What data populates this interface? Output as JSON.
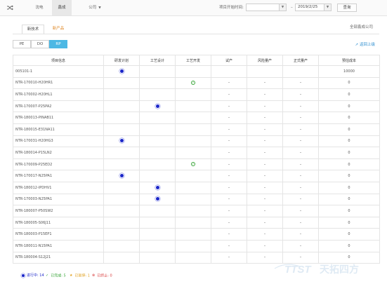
{
  "topbar": {
    "nav": [
      "沈电",
      "鑫成",
      "公司"
    ],
    "date_label": "项目开始时间:",
    "start_date": "",
    "end_date": "2019/2/25",
    "query_label": "查询"
  },
  "tabs": [
    "新技术",
    "新产品"
  ],
  "company_label": "全部鑫成公司",
  "segments": [
    "PE",
    "DO",
    "RP"
  ],
  "back_label": "返回上级",
  "table": {
    "headers": [
      "项目信息",
      "研发计划",
      "工艺设计",
      "工艺开发",
      "试产",
      "风险量产",
      "正式量产",
      "预估成本"
    ],
    "rows": [
      {
        "name": "005101-1",
        "rd": "dot",
        "design": "",
        "dev": "",
        "trial": "",
        "risk": "",
        "mass": "",
        "cost": "10000"
      },
      {
        "name": "NTR-170010-H20HR1",
        "rd": "",
        "design": "",
        "dev": "check",
        "trial": "–",
        "risk": "–",
        "mass": "–",
        "cost": "0"
      },
      {
        "name": "NTR-170002-H20HL1",
        "rd": "",
        "design": "",
        "dev": "",
        "trial": "–",
        "risk": "–",
        "mass": "–",
        "cost": "0"
      },
      {
        "name": "NTR-170007-P25PA2",
        "rd": "",
        "design": "dot",
        "dev": "",
        "trial": "–",
        "risk": "–",
        "mass": "–",
        "cost": "0"
      },
      {
        "name": "NTR-180013-PINAB11",
        "rd": "",
        "design": "",
        "dev": "",
        "trial": "–",
        "risk": "–",
        "mass": "–",
        "cost": "0"
      },
      {
        "name": "NTR-180015-E31NA11",
        "rd": "",
        "design": "",
        "dev": "",
        "trial": "–",
        "risk": "–",
        "mass": "–",
        "cost": "0"
      },
      {
        "name": "NTR-170031-H20HG3",
        "rd": "dot",
        "design": "",
        "dev": "",
        "trial": "–",
        "risk": "–",
        "mass": "–",
        "cost": "0"
      },
      {
        "name": "NTR-180014-P15LN2",
        "rd": "",
        "design": "",
        "dev": "",
        "trial": "–",
        "risk": "–",
        "mass": "–",
        "cost": "0"
      },
      {
        "name": "NTR-170009-P25ED2",
        "rd": "",
        "design": "",
        "dev": "check",
        "trial": "–",
        "risk": "–",
        "mass": "–",
        "cost": "0"
      },
      {
        "name": "NTR-170017-N25PA1",
        "rd": "dot",
        "design": "",
        "dev": "",
        "trial": "–",
        "risk": "–",
        "mass": "–",
        "cost": "0"
      },
      {
        "name": "NTR-180012-IPDHV1",
        "rd": "",
        "design": "dot",
        "dev": "",
        "trial": "–",
        "risk": "–",
        "mass": "–",
        "cost": "0"
      },
      {
        "name": "NTR-170003-N25PA1",
        "rd": "",
        "design": "dot",
        "dev": "",
        "trial": "–",
        "risk": "–",
        "mass": "–",
        "cost": "0"
      },
      {
        "name": "NTR-180007-P50SW2",
        "rd": "",
        "design": "",
        "dev": "",
        "trial": "–",
        "risk": "–",
        "mass": "–",
        "cost": "0"
      },
      {
        "name": "NTR-180005-S06J11",
        "rd": "",
        "design": "",
        "dev": "",
        "trial": "–",
        "risk": "–",
        "mass": "–",
        "cost": "0"
      },
      {
        "name": "NTR-180003-P15EP1",
        "rd": "",
        "design": "",
        "dev": "",
        "trial": "–",
        "risk": "–",
        "mass": "–",
        "cost": "0"
      },
      {
        "name": "NTR-180011-N15PA1",
        "rd": "",
        "design": "",
        "dev": "",
        "trial": "–",
        "risk": "–",
        "mass": "–",
        "cost": "0"
      },
      {
        "name": "NTR-180004-S12J21",
        "rd": "",
        "design": "",
        "dev": "",
        "trial": "–",
        "risk": "–",
        "mass": "–",
        "cost": "0"
      }
    ]
  },
  "legend": [
    {
      "label": "进行中: 14",
      "symbol": "dot",
      "color": "#1b26c9"
    },
    {
      "label": "已完成: 5",
      "symbol": "check",
      "color": "#3aa63a"
    },
    {
      "label": "已暂停: 1",
      "symbol": "star",
      "color": "#e0a020"
    },
    {
      "label": "已终止: 0",
      "symbol": "x",
      "color": "#d83a3a"
    }
  ],
  "colors": {
    "accent": "#4cb8e4",
    "link": "#2f8fd0",
    "in_progress": "#1b26c9",
    "done": "#3aa63a"
  }
}
